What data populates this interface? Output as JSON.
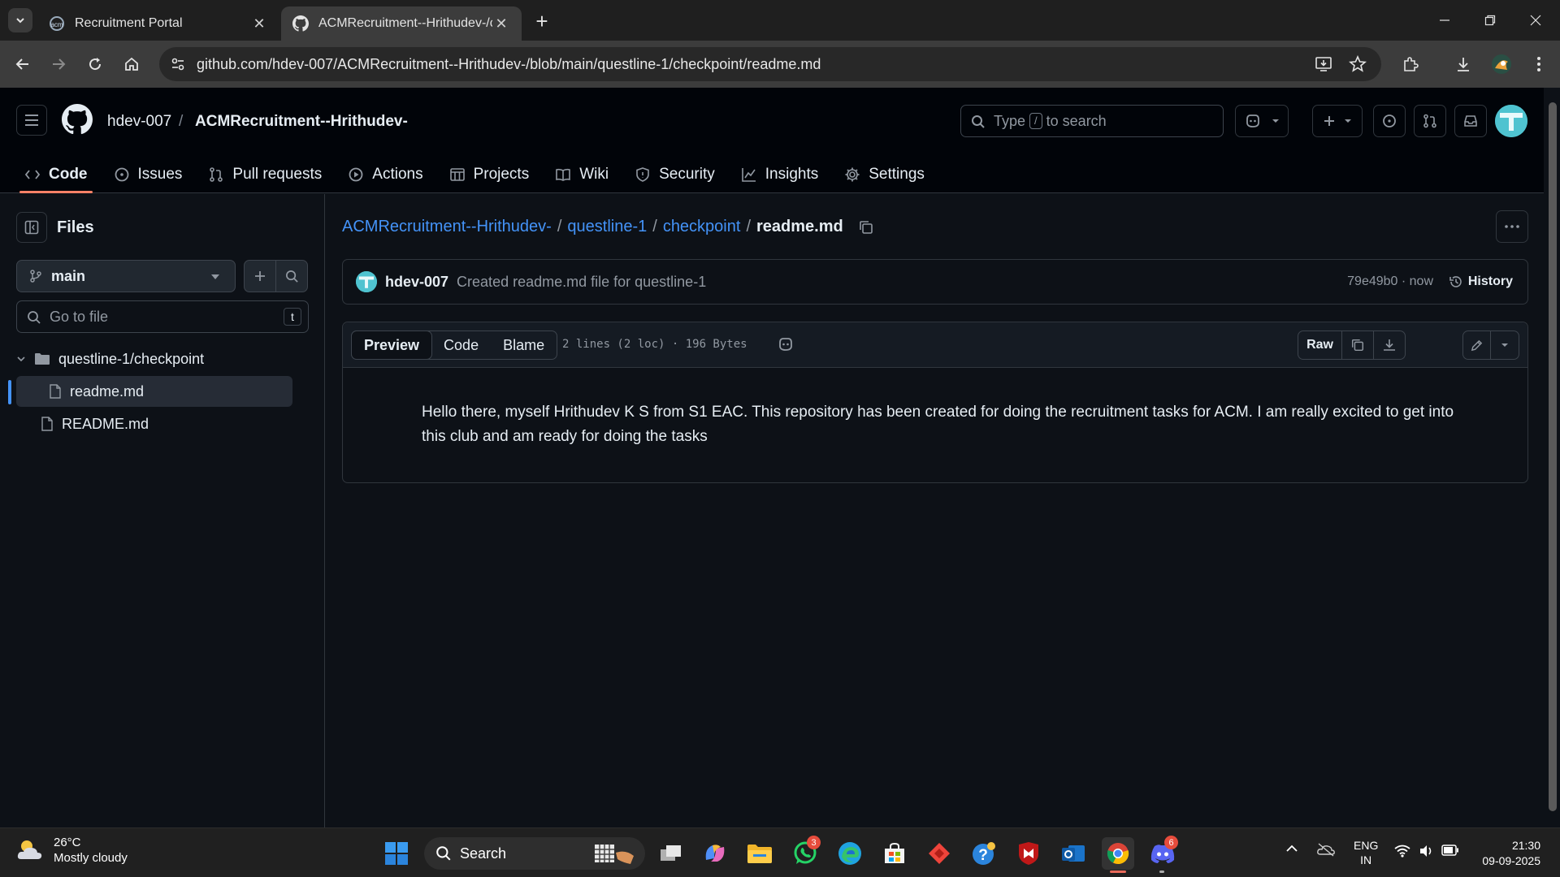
{
  "browser": {
    "tabs": [
      {
        "title": "Recruitment Portal",
        "active": false
      },
      {
        "title": "ACMRecruitment--Hrithudev-/c",
        "active": true
      }
    ],
    "url": "github.com/hdev-007/ACMRecruitment--Hrithudev-/blob/main/questline-1/checkpoint/readme.md"
  },
  "header": {
    "owner": "hdev-007",
    "separator": "/",
    "repo": "ACMRecruitment--Hrithudev-",
    "search": {
      "prefix": "Type",
      "key": "/",
      "suffix": "to search"
    }
  },
  "repo_nav": [
    {
      "label": "Code",
      "icon": "code-icon",
      "selected": true
    },
    {
      "label": "Issues",
      "icon": "issue-icon"
    },
    {
      "label": "Pull requests",
      "icon": "pull-request-icon"
    },
    {
      "label": "Actions",
      "icon": "play-icon"
    },
    {
      "label": "Projects",
      "icon": "table-icon"
    },
    {
      "label": "Wiki",
      "icon": "book-icon"
    },
    {
      "label": "Security",
      "icon": "shield-icon"
    },
    {
      "label": "Insights",
      "icon": "graph-icon"
    },
    {
      "label": "Settings",
      "icon": "gear-icon"
    }
  ],
  "sidebar": {
    "title": "Files",
    "branch": "main",
    "go_to_file": "Go to file",
    "go_to_file_key": "t",
    "tree": [
      {
        "label": "questline-1/checkpoint",
        "type": "folder",
        "expanded": true
      },
      {
        "label": "readme.md",
        "type": "file",
        "selected": true
      },
      {
        "label": "README.md",
        "type": "file"
      }
    ]
  },
  "breadcrumb": {
    "repo": "ACMRecruitment--Hrithudev-",
    "dir1": "questline-1",
    "dir2": "checkpoint",
    "sep": "/",
    "file": "readme.md"
  },
  "commit": {
    "author": "hdev-007",
    "message": "Created readme.md file for questline-1",
    "sha_time": "79e49b0 · now",
    "history": "History"
  },
  "file": {
    "tabs": [
      "Preview",
      "Code",
      "Blame"
    ],
    "active_tab": "Preview",
    "info": "2 lines (2 loc) · 196 Bytes",
    "raw": "Raw",
    "content": "Hello there, myself Hrithudev K S from S1 EAC. This repository has been created for doing the recruitment tasks for ACM. I am really excited to get into this club and am ready for doing the tasks"
  },
  "taskbar": {
    "temperature": "26°C",
    "condition": "Mostly cloudy",
    "search": "Search",
    "whatsapp_badge": "3",
    "discord_badge": "6",
    "lang_top": "ENG",
    "lang_bottom": "IN",
    "time": "21:30",
    "date": "09-09-2025"
  },
  "colors": {
    "accent_link": "#4493f8",
    "selected_underline": "#f78166",
    "bg": "#0d1117"
  }
}
